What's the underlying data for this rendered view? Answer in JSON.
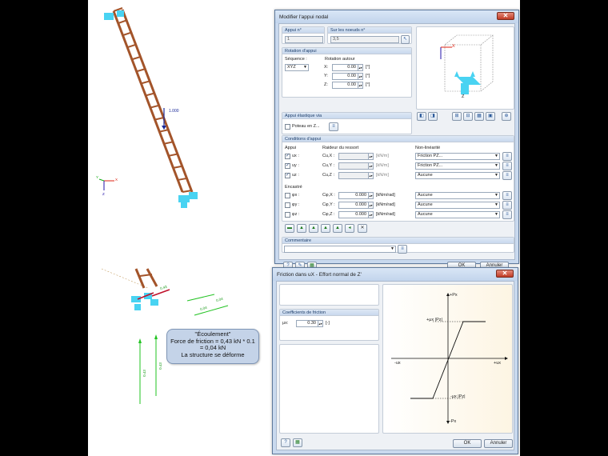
{
  "model_view": {
    "load_label": "1.000",
    "axis_x": "X",
    "axis_y": "Y",
    "axis_z": "Z",
    "force_labels": [
      "0.04",
      "0.04",
      "0.43",
      "0.43",
      "0.43"
    ],
    "callout": {
      "title": "\"Écoulement\"",
      "line1": "Force de friction = 0,43 kN * 0.1",
      "line2": "= 0,04 kN",
      "line3": "La structure se déforme"
    }
  },
  "dialog1": {
    "title": "Modifier l'appui nodal",
    "close_label": "✕",
    "support_no_header": "Appui n°",
    "support_no_value": "1",
    "nodes_header": "Sur les noeuds n°",
    "nodes_value": "3,5",
    "rotation_group": "Rotation d'appui",
    "sequence_label": "Séquence :",
    "sequence_value": "XYZ",
    "rotation_about_label": "Rotation autour",
    "rot_x_label": "X:",
    "rot_y_label": "Y:",
    "rot_z_label": "Z:",
    "rot_x_value": "0.00",
    "rot_y_value": "0.00",
    "rot_z_value": "0.00",
    "deg_unit": "[°]",
    "elastic_group": "Appui élastique via",
    "column_label": "Poteau en Z...",
    "conditions_group": "Conditions d'appui",
    "support_col": "Appui",
    "spring_col": "Raideur du ressort",
    "nonlin_col": "Non-linéarité",
    "ux_label": "ux :",
    "uy_label": "uy :",
    "uz_label": "uz :",
    "cux_label": "Cu,X :",
    "cuy_label": "Cu,Y :",
    "cuz_label": "Cu,Z :",
    "kn_unit": "[kN/m]",
    "nonlin_ux": "Friction PZ...",
    "nonlin_uy": "Friction PZ...",
    "nonlin_uz": "Aucune",
    "fixity_label": "Encastré",
    "phix_label": "φx :",
    "phiy_label": "φy :",
    "phiz_label": "φz :",
    "cphix_label": "Cφ,X :",
    "cphiy_label": "Cφ,Y :",
    "cphiz_label": "Cφ,Z :",
    "cphix_value": "0.000",
    "cphiy_value": "0.000",
    "cphiz_value": "0.000",
    "knm_unit": "[kNm/rad]",
    "nonlin_phix": "Aucune",
    "nonlin_phiy": "Aucune",
    "nonlin_phiz": "Aucune",
    "comment_group": "Commentaire",
    "ok_label": "OK",
    "cancel_label": "Annuler",
    "preview_x": "X",
    "preview_z": "Z"
  },
  "dialog2": {
    "title": "Friction dans uX - Effort normal de Z'",
    "close_label": "✕",
    "coef_group": "Coefficients de friction",
    "mu_label": "μx:",
    "mu_value": "0.30",
    "mu_unit": "[-]",
    "ok_label": "OK",
    "cancel_label": "Annuler",
    "graph": {
      "top_label": "+Px",
      "bottom_label": "-Px",
      "left_label": "-ux",
      "right_label": "+ux",
      "upper_label": "+μx |Pz|",
      "lower_label": "-μx |Pz|"
    }
  }
}
